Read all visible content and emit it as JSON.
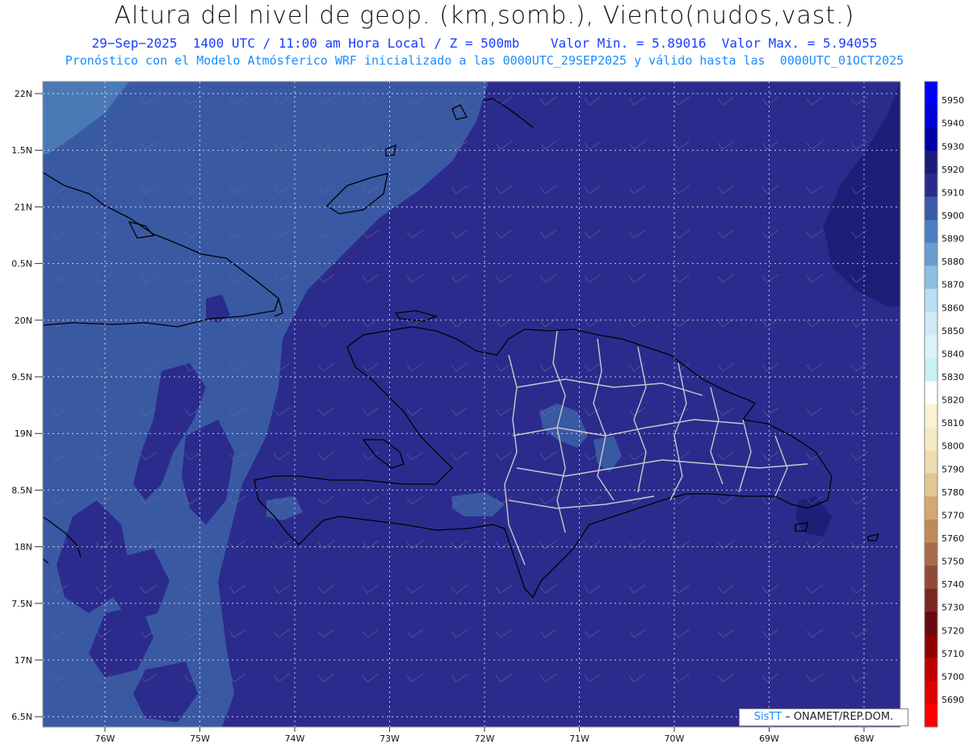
{
  "title": "Altura del nivel de geop. (km,somb.), Viento(nudos,vast.)",
  "subtitle_line1": "29−Sep−2025  1400 UTC / 11:00 am Hora Local / Z = 500mb    Valor Min. = 5.89016  Valor Max. = 5.94055",
  "subtitle_line2": "Pronóstico con el Modelo Atmósferico WRF inicializado a las 0000UTC_29SEP2025 y válido hasta las  0000UTC_01OCT2025",
  "credit": {
    "brand": "SisTT",
    "text": " –  ONAMET/REP.DOM."
  },
  "lat_labels": [
    "22N",
    "1.5N",
    "21N",
    "0.5N",
    "20N",
    "9.5N",
    "19N",
    "8.5N",
    "18N",
    "7.5N",
    "17N",
    "6.5N"
  ],
  "lon_labels": [
    "76W",
    "75W",
    "74W",
    "73W",
    "72W",
    "71W",
    "70W",
    "69W",
    "68W"
  ],
  "colorbar": {
    "levels": [
      5950,
      5940,
      5930,
      5920,
      5910,
      5900,
      5890,
      5880,
      5870,
      5860,
      5850,
      5840,
      5830,
      5820,
      5810,
      5800,
      5790,
      5780,
      5770,
      5760,
      5750,
      5740,
      5730,
      5720,
      5710,
      5700,
      5690
    ],
    "colors": [
      "#0000ff",
      "#0000d8",
      "#0000a8",
      "#1a1a7a",
      "#2a2a8c",
      "#3a5aa8",
      "#4a7ec0",
      "#6a9cd0",
      "#8cc0e0",
      "#b8e0f0",
      "#cdeaf5",
      "#ddf1f8",
      "#c8f0f5",
      "#ffffff",
      "#fbf3d0",
      "#f6eac4",
      "#eedcb0",
      "#e2c690",
      "#d4a870",
      "#c08a58",
      "#a86a48",
      "#904a38",
      "#7a2820",
      "#6a0810",
      "#900000",
      "#c00000",
      "#e00000",
      "#ff0000"
    ]
  },
  "map_colors": {
    "deep": "#2b2b8e",
    "medium": "#3a59a3",
    "light": "#4a7ab5",
    "darkest": "#1e1e78"
  }
}
